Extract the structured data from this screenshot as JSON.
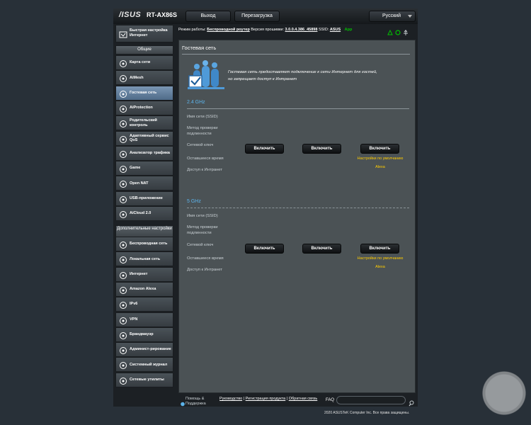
{
  "header": {
    "logo": "/ISUS",
    "model": "RT-AX86S",
    "logout_label": "Выход",
    "reboot_label": "Перезагрузка",
    "language": "Русский"
  },
  "infobar": {
    "mode_label": "Режим работы:",
    "mode_value": "Беспроводной роутер",
    "firmware_label": "Версия прошивки:",
    "firmware_value": "3.0.0.4.386_45898",
    "ssid_label": "SSID:",
    "ssid_value": "ASUS",
    "app_label": "App"
  },
  "sidebar": {
    "qis_label": "Быстрая настройка Интернет",
    "general_header": "Общие",
    "general_items": [
      {
        "label": "Карта сети",
        "icon": "network-map-icon"
      },
      {
        "label": "AiMesh",
        "icon": "aimesh-icon"
      },
      {
        "label": "Гостевая сеть",
        "icon": "guest-network-icon",
        "active": true
      },
      {
        "label": "AiProtection",
        "icon": "aiprotection-icon"
      },
      {
        "label": "Родительский контроль",
        "icon": "parental-control-icon"
      },
      {
        "label": "Адаптивный сервис QoS",
        "icon": "qos-icon"
      },
      {
        "label": "Анализатор трафика",
        "icon": "traffic-analyzer-icon"
      },
      {
        "label": "Game",
        "icon": "gamepad-icon"
      },
      {
        "label": "Open NAT",
        "icon": "open-nat-icon"
      },
      {
        "label": "USB-приложение",
        "icon": "usb-icon"
      },
      {
        "label": "AiCloud 2.0",
        "icon": "cloud-icon"
      }
    ],
    "advanced_header": "Дополнительные настройки",
    "advanced_items": [
      {
        "label": "Беспроводная сеть",
        "icon": "wireless-icon"
      },
      {
        "label": "Локальная сеть",
        "icon": "lan-icon"
      },
      {
        "label": "Интернет",
        "icon": "globe-icon"
      },
      {
        "label": "Amazon Alexa",
        "icon": "alexa-icon"
      },
      {
        "label": "IPv6",
        "icon": "ipv6-icon"
      },
      {
        "label": "VPN",
        "icon": "vpn-icon"
      },
      {
        "label": "Брандмауэр",
        "icon": "firewall-icon"
      },
      {
        "label": "Админист-рирование",
        "icon": "administration-icon"
      },
      {
        "label": "Системный журнал",
        "icon": "system-log-icon"
      },
      {
        "label": "Сетевые утилиты",
        "icon": "network-tools-icon"
      }
    ]
  },
  "main": {
    "title": "Гостевая сеть",
    "description_line1": "Гостевая сеть предоставляет подключение к сети Интернет для гостей,",
    "description_line2": "но запрещает доступ к Интранет",
    "bands": [
      {
        "name": "2.4 GHz",
        "fields": [
          "Имя сети (SSID)",
          "Метод проверки подлинности",
          "Сетевой ключ",
          "Оставшееся время",
          "Доступ к Интранет"
        ],
        "buttons": [
          "Включить",
          "Включить",
          "Включить"
        ],
        "default_link": "Настройки по умолчанию",
        "alexa": "Alexa"
      },
      {
        "name": "5 GHz",
        "fields": [
          "Имя сети (SSID)",
          "Метод проверки подлинности",
          "Сетевой ключ",
          "Оставшееся время",
          "Доступ к Интранет"
        ],
        "buttons": [
          "Включить",
          "Включить",
          "Включить"
        ],
        "default_link": "Настройки по умолчанию",
        "alexa": "Alexa"
      }
    ]
  },
  "footer": {
    "help_label": "Помощь & Поддержка",
    "manual": "Руководство",
    "registration": "Регистрация продукта",
    "feedback": "Обратная связь",
    "faq": "FAQ",
    "copyright": "2020 ASUSTeK Computer Inc. Все права защищены."
  },
  "colors": {
    "accent_blue": "#5cb3ea",
    "link_yellow": "#ffcc00",
    "app_green": "#00c000",
    "active_menu": "#6f8cab"
  }
}
